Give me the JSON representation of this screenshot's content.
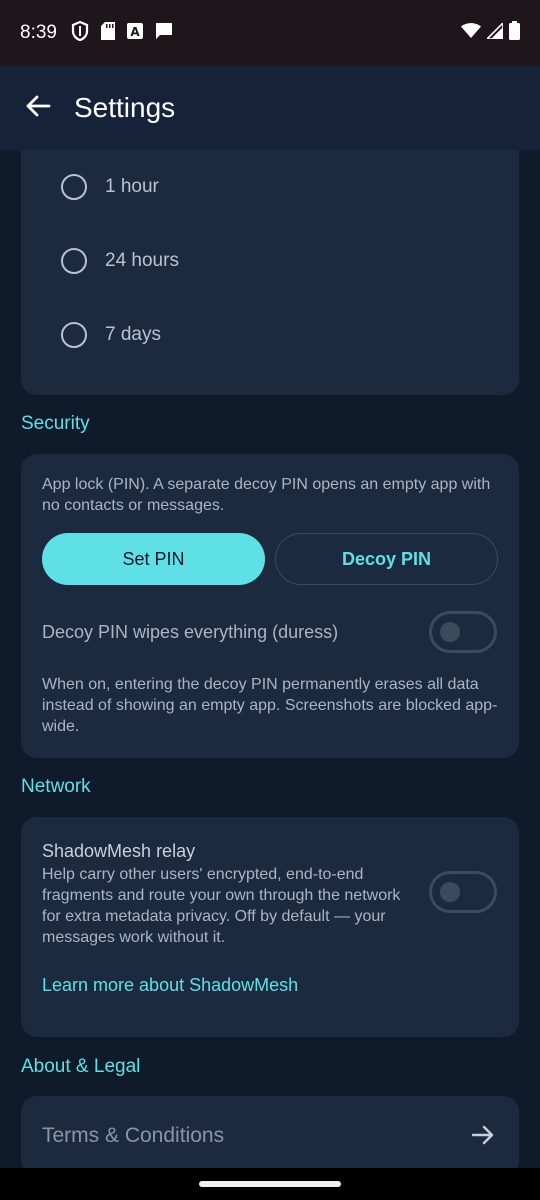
{
  "status_bar": {
    "time": "8:39",
    "icons_left": [
      "shield-icon",
      "sd-card-icon",
      "a-badge-icon",
      "message-icon"
    ],
    "icons_right": [
      "wifi-icon",
      "signal-icon",
      "battery-icon"
    ]
  },
  "top_bar": {
    "title": "Settings"
  },
  "retention_options": [
    {
      "label": "1 hour",
      "selected": false
    },
    {
      "label": "24 hours",
      "selected": false
    },
    {
      "label": "7 days",
      "selected": false
    }
  ],
  "security": {
    "header": "Security",
    "description": "App lock (PIN). A separate decoy PIN opens an empty app with no contacts or messages.",
    "set_pin_label": "Set PIN",
    "decoy_pin_label": "Decoy PIN",
    "duress_label": "Decoy PIN wipes everything (duress)",
    "duress_enabled": false,
    "duress_note": "When on, entering the decoy PIN permanently erases all data instead of showing an empty app. Screenshots are blocked app-wide."
  },
  "network": {
    "header": "Network",
    "relay_title": "ShadowMesh relay",
    "relay_description": "Help carry other users' encrypted, end-to-end fragments and route your own through the network for extra metadata privacy. Off by default — your messages work without it.",
    "relay_enabled": false,
    "learn_more": "Learn more about ShadowMesh"
  },
  "about": {
    "header": "About & Legal",
    "terms_label": "Terms & Conditions"
  },
  "colors": {
    "accent": "#5ee0e6",
    "background": "#0f1a2b",
    "card": "#1c2a40",
    "top_bar": "#15223a"
  }
}
